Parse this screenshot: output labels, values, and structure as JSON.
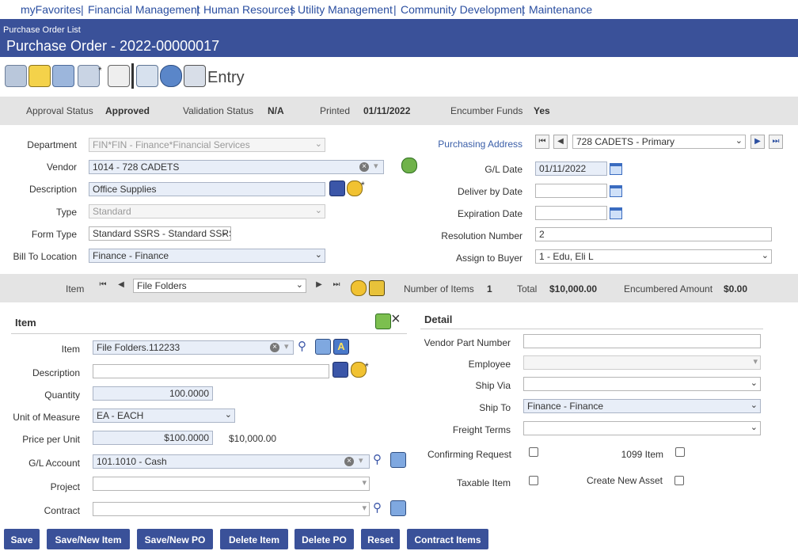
{
  "nav": {
    "items": [
      "myFavorites",
      "Financial Management",
      "Human Resources",
      "Utility Management",
      "Community Development",
      "Maintenance"
    ]
  },
  "header": {
    "breadcrumb": "Purchase Order List",
    "title": "Purchase Order - 2022-00000017"
  },
  "toolbar": {
    "mode": "Entry"
  },
  "status": {
    "approval_label": "Approval Status",
    "approval_value": "Approved",
    "validation_label": "Validation Status",
    "validation_value": "N/A",
    "printed_label": "Printed",
    "printed_value": "01/11/2022",
    "encumber_label": "Encumber Funds",
    "encumber_value": "Yes"
  },
  "form": {
    "department_label": "Department",
    "department_value": "FIN*FIN - Finance*Financial Services",
    "vendor_label": "Vendor",
    "vendor_value": "1014 - 728 CADETS",
    "description_label": "Description",
    "description_value": "Office Supplies",
    "type_label": "Type",
    "type_value": "Standard",
    "formtype_label": "Form Type",
    "formtype_value": "Standard SSRS - Standard SSRS",
    "billto_label": "Bill To Location",
    "billto_value": "Finance - Finance",
    "purchasing_address_label": "Purchasing Address",
    "purchasing_address_value": "728 CADETS - Primary",
    "gldate_label": "G/L Date",
    "gldate_value": "01/11/2022",
    "deliver_label": "Deliver by Date",
    "deliver_value": "",
    "expiration_label": "Expiration Date",
    "expiration_value": "",
    "resolution_label": "Resolution Number",
    "resolution_value": "2",
    "buyer_label": "Assign to Buyer",
    "buyer_value": "1 - Edu, Eli L"
  },
  "item_band": {
    "item_label": "Item",
    "item_value": "File Folders",
    "count_label": "Number of Items",
    "count_value": "1",
    "total_label": "Total",
    "total_value": "$10,000.00",
    "encumbered_label": "Encumbered Amount",
    "encumbered_value": "$0.00"
  },
  "item_section": {
    "heading": "Item",
    "item_label": "Item",
    "item_value": "File Folders.112233",
    "description_label": "Description",
    "description_value": "",
    "quantity_label": "Quantity",
    "quantity_value": "100.0000",
    "uom_label": "Unit of Measure",
    "uom_value": "EA - EACH",
    "price_label": "Price per Unit",
    "price_value": "$100.0000",
    "extended_value": "$10,000.00",
    "glaccount_label": "G/L Account",
    "glaccount_value": "101.1010 - Cash",
    "project_label": "Project",
    "project_value": "",
    "contract_label": "Contract",
    "contract_value": ""
  },
  "detail_section": {
    "heading": "Detail",
    "vpn_label": "Vendor Part Number",
    "vpn_value": "",
    "employee_label": "Employee",
    "employee_value": "",
    "shipvia_label": "Ship Via",
    "shipvia_value": "",
    "shipto_label": "Ship To",
    "shipto_value": "Finance - Finance",
    "freight_label": "Freight Terms",
    "freight_value": "",
    "confirming_label": "Confirming Request",
    "item1099_label": "1099 Item",
    "taxable_label": "Taxable Item",
    "newasset_label": "Create New Asset"
  },
  "buttons": [
    "Save",
    "Save/New Item",
    "Save/New PO",
    "Delete Item",
    "Delete PO",
    "Reset",
    "Contract Items"
  ],
  "colors": {
    "header": "#3a5199",
    "band": "#e4e4e4",
    "nav_link": "#2a4ea0"
  }
}
